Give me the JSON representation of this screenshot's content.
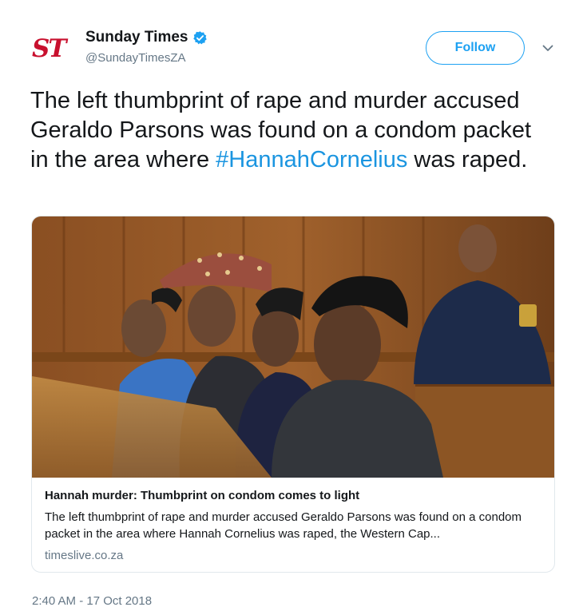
{
  "account": {
    "logo_text": "ST",
    "display_name": "Sunday Times",
    "handle": "@SundayTimesZA",
    "verified": true
  },
  "actions": {
    "follow_label": "Follow",
    "more_icon": "chevron-down-icon"
  },
  "tweet": {
    "text_before": "The left thumbprint of rape and murder accused Geraldo Parsons was found on a condom packet in the area where ",
    "hashtag": "#HannahCornelius",
    "text_after": " was raped."
  },
  "card": {
    "image_icon": "courtroom-photo",
    "title": "Hannah murder: Thumbprint on condom comes to light",
    "description": "The left thumbprint of rape and murder accused Geraldo Parsons was found on a condom packet in the area where Hannah Cornelius was raped, the Western Cap...",
    "domain": "timeslive.co.za"
  },
  "meta": {
    "timestamp": "2:40 AM - 17 Oct 2018"
  },
  "colors": {
    "brand_red": "#c8102e",
    "twitter_blue": "#1da1f2",
    "hashtag_blue": "#1b95e0",
    "muted_gray": "#657786"
  }
}
